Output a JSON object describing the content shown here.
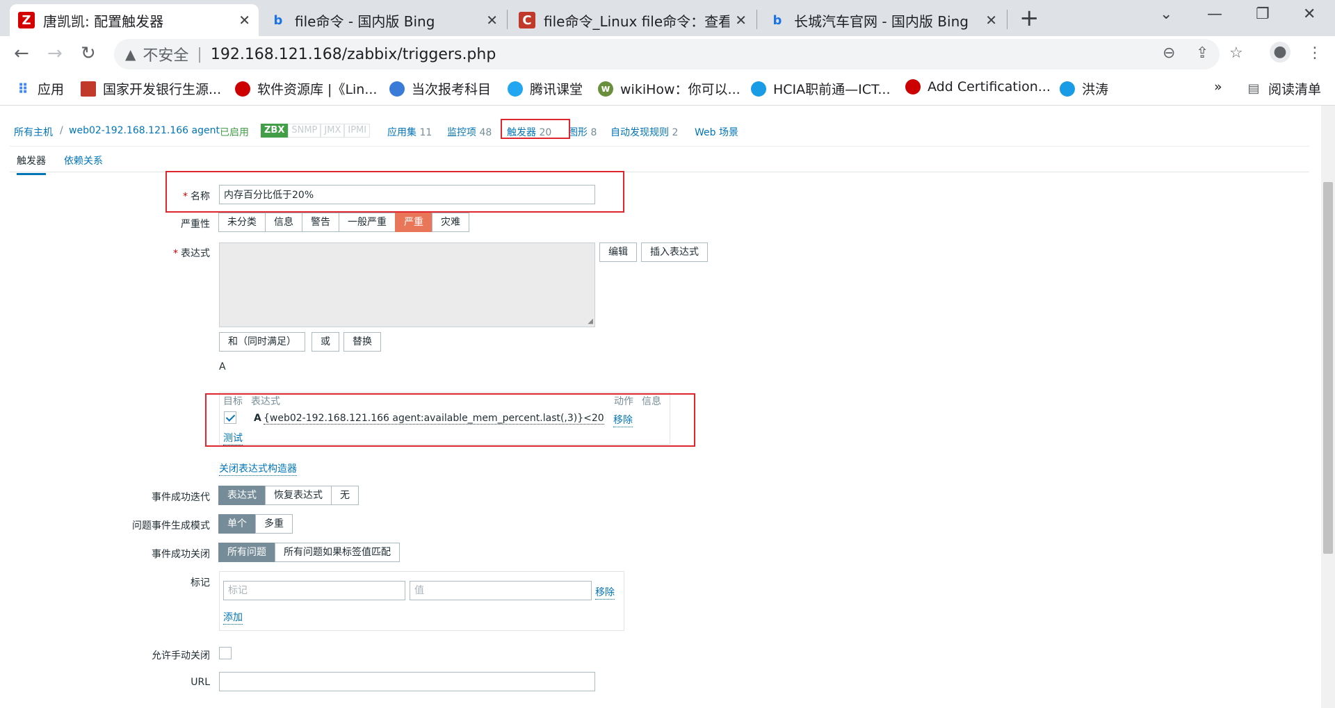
{
  "browser": {
    "tabs": [
      {
        "title": "唐凯凯: 配置触发器",
        "favicon": "Z",
        "favicon_color": "#d40000"
      },
      {
        "title": "file命令 - 国内版 Bing",
        "favicon": "b",
        "favicon_color": "#1a73e8"
      },
      {
        "title": "file命令_Linux file命令：查看文件",
        "favicon": "C",
        "favicon_color": "#c0392b"
      },
      {
        "title": "长城汽车官网 - 国内版 Bing",
        "favicon": "b",
        "favicon_color": "#1a73e8"
      }
    ],
    "new_tab": "+",
    "address": {
      "warning": "不安全",
      "separator": "|",
      "url": "192.168.121.168/zabbix/triggers.php"
    },
    "bookmarks": [
      {
        "label": "应用",
        "color": "#4285f4"
      },
      {
        "label": "国家开发银行生源...",
        "color": "#c0392b"
      },
      {
        "label": "软件资源库 |《Lin...",
        "color": "#cc0000"
      },
      {
        "label": "当次报考科目",
        "color": "#3b7bd8"
      },
      {
        "label": "腾讯课堂",
        "color": "#23a6f0"
      },
      {
        "label": "wikiHow：你可以...",
        "color": "#6a8f3c"
      },
      {
        "label": "HCIA职前通—ICT...",
        "color": "#1a9be6"
      },
      {
        "label": "Add Certification...",
        "color": "#cc0000"
      },
      {
        "label": "洪涛",
        "color": "#1a9be6"
      }
    ],
    "more": "»",
    "reading_list": "阅读清单"
  },
  "hostnav": {
    "all_hosts": "所有主机",
    "sep": "/",
    "host": "web02-192.168.121.166 agent",
    "enabled": "已启用",
    "protocols": [
      "ZBX",
      "SNMP",
      "JMX",
      "IPMI"
    ],
    "apps": {
      "label": "应用集",
      "count": "11"
    },
    "items": {
      "label": "监控项",
      "count": "48"
    },
    "triggers": {
      "label": "触发器",
      "count": "20"
    },
    "graphs": {
      "label": "图形",
      "count": "8"
    },
    "discovery": {
      "label": "自动发现规则",
      "count": "2"
    },
    "web": {
      "label": "Web 场景"
    }
  },
  "form_tabs": [
    "触发器",
    "依赖关系"
  ],
  "form": {
    "name_label": "名称",
    "name_value": "内存百分比低于20%",
    "severity_label": "严重性",
    "severity_options": [
      "未分类",
      "信息",
      "警告",
      "一般严重",
      "严重",
      "灾难"
    ],
    "severity_selected": "严重",
    "expression_label": "表达式",
    "edit_button": "编辑",
    "insert_expression_button": "插入表达式",
    "and_button": "和（同时满足）",
    "or_button": "或",
    "replace_button": "替换",
    "expression_preview": "A",
    "constructor": {
      "col_target": "目标",
      "col_expression": "表达式",
      "col_action": "动作",
      "col_info": "信息",
      "row_letter": "A",
      "row_expression": "{web02-192.168.121.166 agent:available_mem_percent.last(,3)}<20",
      "row_action": "移除",
      "test_link": "测试"
    },
    "close_constructor": "关闭表达式构造器",
    "ok_event_gen_label": "事件成功迭代",
    "ok_event_gen_options": [
      "表达式",
      "恢复表达式",
      "无"
    ],
    "problem_mode_label": "问题事件生成模式",
    "problem_mode_options": [
      "单个",
      "多重"
    ],
    "ok_close_label": "事件成功关闭",
    "ok_close_options": [
      "所有问题",
      "所有问题如果标签值匹配"
    ],
    "tags_label": "标记",
    "tag_placeholder": "标记",
    "value_placeholder": "值",
    "tag_remove": "移除",
    "tag_add": "添加",
    "manual_close_label": "允许手动关闭",
    "url_label": "URL"
  }
}
